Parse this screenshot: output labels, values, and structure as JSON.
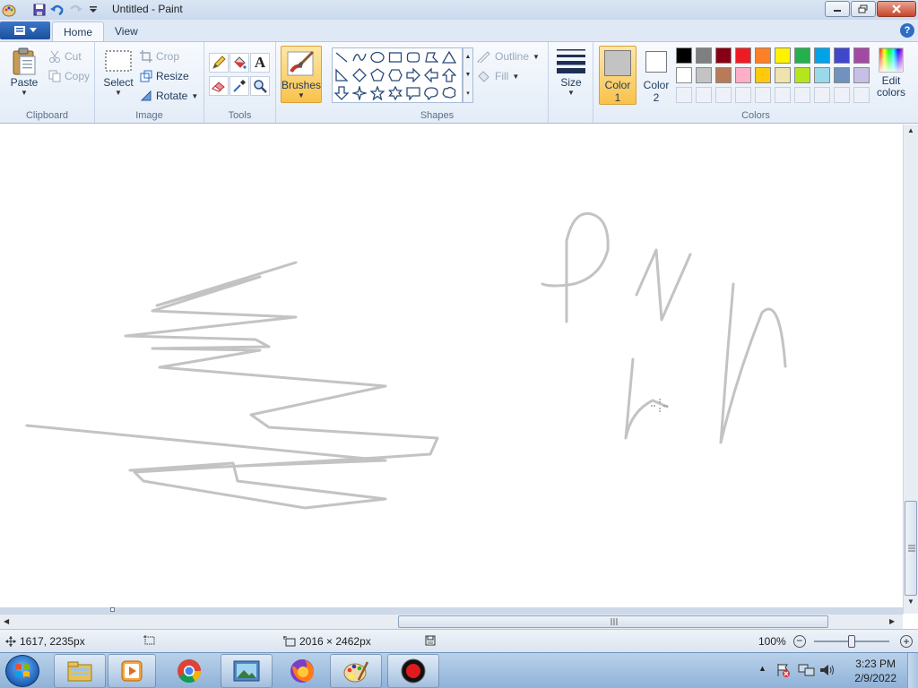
{
  "window": {
    "title": "Untitled - Paint"
  },
  "tabs": [
    {
      "label": "Home"
    },
    {
      "label": "View"
    }
  ],
  "ribbon": {
    "clipboard": {
      "label": "Clipboard",
      "paste": "Paste",
      "cut": "Cut",
      "copy": "Copy"
    },
    "image": {
      "label": "Image",
      "select": "Select",
      "crop": "Crop",
      "resize": "Resize",
      "rotate": "Rotate"
    },
    "tools": {
      "label": "Tools"
    },
    "brushes": {
      "label": "Brushes"
    },
    "shapes": {
      "label": "Shapes",
      "outline": "Outline",
      "fill": "Fill"
    },
    "size": {
      "label": "Size"
    },
    "colors": {
      "label": "Colors",
      "color1_line1": "Color",
      "color1_line2": "1",
      "color2_line1": "Color",
      "color2_line2": "2",
      "edit_line1": "Edit",
      "edit_line2": "colors",
      "color1_value": "#c3c3c3",
      "color2_value": "#ffffff",
      "palette_row1": [
        "#000000",
        "#7f7f7f",
        "#880015",
        "#ed1c24",
        "#ff7f27",
        "#fff200",
        "#22b14c",
        "#00a2e8",
        "#3f48cc",
        "#a349a4"
      ],
      "palette_row2": [
        "#ffffff",
        "#c3c3c3",
        "#b97a57",
        "#ffaec9",
        "#ffc90e",
        "#efe4b0",
        "#b5e61d",
        "#99d9ea",
        "#7092be",
        "#c8bfe7"
      ]
    }
  },
  "status": {
    "cursor_pos": "1617, 2235px",
    "image_size": "2016 × 2462px",
    "zoom": "100%"
  },
  "taskbar": {
    "apps": [
      "explorer-icon",
      "media-player-icon",
      "chrome-icon",
      "photos-icon",
      "firefox-icon",
      "paint-icon",
      "recorder-icon"
    ],
    "time": "3:23 PM",
    "date": "2/9/2022"
  }
}
